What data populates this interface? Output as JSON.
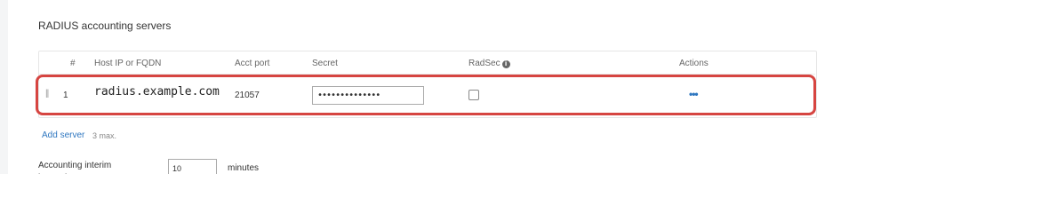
{
  "section": {
    "title": "RADIUS accounting servers"
  },
  "table": {
    "headers": {
      "index": "#",
      "host": "Host IP or FQDN",
      "port": "Acct port",
      "secret": "Secret",
      "radsec": "RadSec",
      "actions": "Actions"
    },
    "rows": [
      {
        "index": "1",
        "host": "radius.example.com",
        "port": "21057",
        "secret": "••••••••••••••",
        "radsec_checked": false
      }
    ]
  },
  "add_server": {
    "label": "Add server",
    "note": "3 max."
  },
  "interim": {
    "label": "Accounting interim interval",
    "value": "10",
    "unit": "minutes"
  },
  "colors": {
    "highlight": "#d64541",
    "link": "#2f77c0"
  },
  "icons": {
    "drag": "drag-handle-icon",
    "info": "info-icon",
    "actions": "more-actions-icon"
  }
}
